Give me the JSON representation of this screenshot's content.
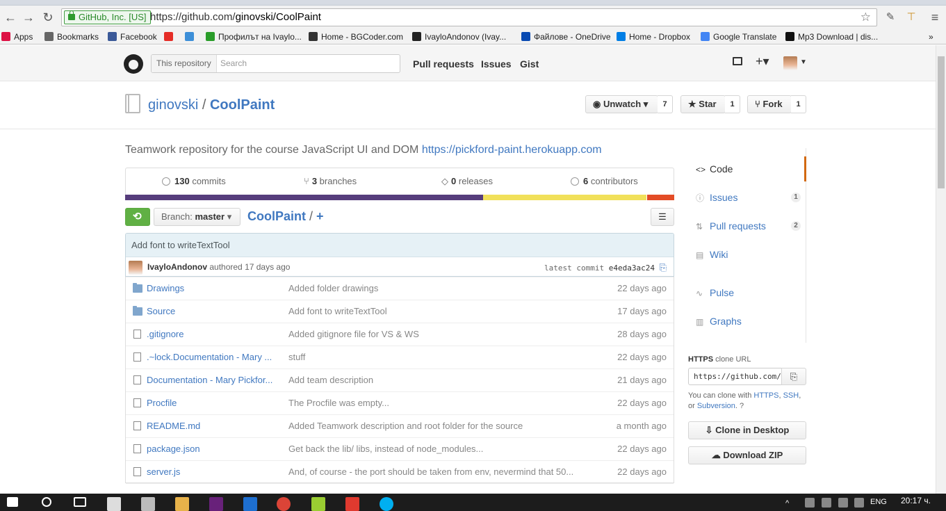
{
  "browser": {
    "ev_label": "GitHub, Inc. [US]",
    "url_host": "https://github.com/",
    "url_path": "ginovski/CoolPaint",
    "bookmarks": [
      {
        "label": "Apps",
        "color": "#d14"
      },
      {
        "label": "Bookmarks",
        "color": "#666"
      },
      {
        "label": "Facebook",
        "color": "#3b5998"
      },
      {
        "label": "",
        "color": "#e52d27"
      },
      {
        "label": "",
        "color": "#3d8fd8"
      },
      {
        "label": "Профилът на Ivaylo...",
        "color": "#2a9d2a"
      },
      {
        "label": "Home - BGCoder.com",
        "color": "#333"
      },
      {
        "label": "IvayloAndonov (Ivay...",
        "color": "#222"
      },
      {
        "label": "Файлове - OneDrive",
        "color": "#094ab2"
      },
      {
        "label": "Home - Dropbox",
        "color": "#007ee5"
      },
      {
        "label": "Google Translate",
        "color": "#4285f4"
      },
      {
        "label": "Mp3 Download | dis...",
        "color": "#111"
      }
    ],
    "more_label": "»"
  },
  "header": {
    "scope": "This repository",
    "search_placeholder": "Search",
    "nav": [
      "Pull requests",
      "Issues",
      "Gist"
    ]
  },
  "repo": {
    "owner": "ginovski",
    "separator": "/",
    "name": "CoolPaint",
    "unwatch_label": "Unwatch",
    "watch_count": "7",
    "star_label": "Star",
    "star_count": "1",
    "fork_label": "Fork",
    "fork_count": "1",
    "description": "Teamwork repository for the course JavaScript UI and DOM",
    "homepage": "https://pickford-paint.herokuapp.com"
  },
  "summary": {
    "commits_count": "130",
    "commits_label": "commits",
    "branches_count": "3",
    "branches_label": "branches",
    "releases_count": "0",
    "releases_label": "releases",
    "contributors_count": "6",
    "contributors_label": "contributors"
  },
  "languages": [
    {
      "color": "#563d7c",
      "share": 0.652
    },
    {
      "color": "#f1e05a",
      "share": 0.298
    },
    {
      "color": "#e34c26",
      "share": 0.05
    }
  ],
  "branch": {
    "label": "Branch:",
    "name": "master"
  },
  "breadcrumb": {
    "repo": "CoolPaint",
    "sep": "/",
    "add": "+"
  },
  "commit": {
    "message": "Add font to writeTextTool",
    "author": "IvayloAndonov",
    "authored": "authored 17 days ago",
    "latest_label": "latest commit",
    "sha": "e4eda3ac24"
  },
  "files": [
    {
      "type": "folder",
      "name": "Drawings",
      "message": "Added folder drawings",
      "age": "22 days ago"
    },
    {
      "type": "folder",
      "name": "Source",
      "message": "Add font to writeTextTool",
      "age": "17 days ago"
    },
    {
      "type": "file",
      "name": ".gitignore",
      "message": "Added gitignore file for VS & WS",
      "age": "28 days ago"
    },
    {
      "type": "file",
      "name": ".~lock.Documentation - Mary ...",
      "message": "stuff",
      "age": "22 days ago"
    },
    {
      "type": "file",
      "name": "Documentation - Mary Pickfor...",
      "message": "Add team description",
      "age": "21 days ago"
    },
    {
      "type": "file",
      "name": "Procfile",
      "message": "The Procfile was empty...",
      "age": "22 days ago"
    },
    {
      "type": "file",
      "name": "README.md",
      "message": "Added Teamwork description and root folder for the source",
      "age": "a month ago"
    },
    {
      "type": "file",
      "name": "package.json",
      "message": "Get back the lib/ libs, instead of node_modules...",
      "age": "22 days ago"
    },
    {
      "type": "file",
      "name": "server.js",
      "message": "And, of course - the port should be taken from env, nevermind that 50...",
      "age": "22 days ago"
    }
  ],
  "sidebar": {
    "code": "Code",
    "issues": "Issues",
    "issues_count": "1",
    "pulls": "Pull requests",
    "pulls_count": "2",
    "wiki": "Wiki",
    "pulse": "Pulse",
    "graphs": "Graphs"
  },
  "clone": {
    "proto": "HTTPS",
    "label": "clone URL",
    "url": "https://github.com/ginovski/CoolPaint.git",
    "help_prefix": "You can clone with",
    "https": "HTTPS",
    "ssh": "SSH",
    "or": "or",
    "subversion": "Subversion",
    "desktop_label": "Clone in Desktop",
    "zip_label": "Download ZIP"
  },
  "taskbar": {
    "lang": "ENG",
    "time": "20:17 ч."
  }
}
